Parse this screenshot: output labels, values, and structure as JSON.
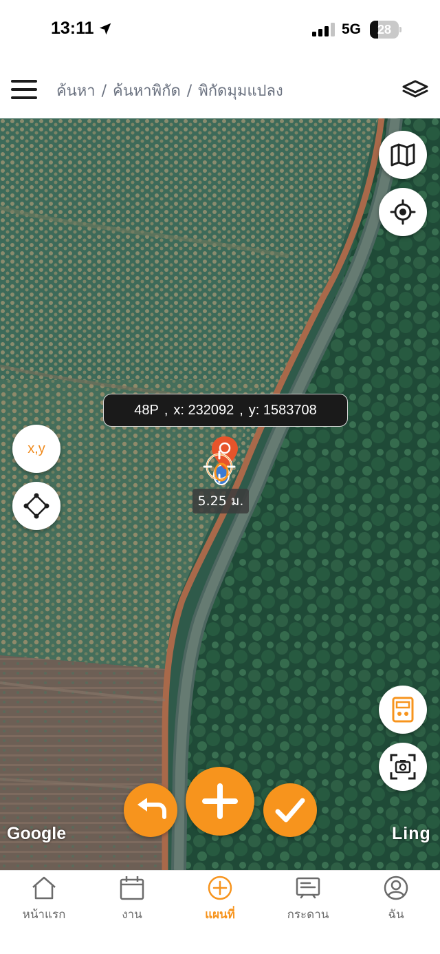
{
  "status_bar": {
    "time": "13:11",
    "network": "5G",
    "battery": 28
  },
  "header": {
    "breadcrumb": [
      "ค้นหา",
      "ค้นหาพิกัด",
      "พิกัดมุมแปลง"
    ],
    "breadcrumb_separator": "/"
  },
  "map": {
    "left_buttons": {
      "xy_label": "x,y"
    },
    "coordinate": {
      "zone": "48P",
      "x": "x: 232092",
      "y": "y: 1583708",
      "separator": ","
    },
    "accuracy_label": "5.25 ม.",
    "attribution_left": "Google",
    "attribution_right": "Ling",
    "icons": [
      "map-icon",
      "target-icon",
      "diamond-icon",
      "calculator-icon",
      "scan-camera-icon",
      "undo-icon",
      "plus-icon",
      "check-icon"
    ]
  },
  "tabs": [
    {
      "label": "หน้าแรก",
      "icon": "home-icon",
      "active": false
    },
    {
      "label": "งาน",
      "icon": "calendar-icon",
      "active": false
    },
    {
      "label": "แผนที่",
      "icon": "plus-circle-icon",
      "active": true
    },
    {
      "label": "กระดาน",
      "icon": "board-icon",
      "active": false
    },
    {
      "label": "ฉัน",
      "icon": "user-icon",
      "active": false
    }
  ],
  "colors": {
    "accent": "#f7941d",
    "pin": "#e8542a",
    "inactive_tab": "#6b6b6b"
  }
}
